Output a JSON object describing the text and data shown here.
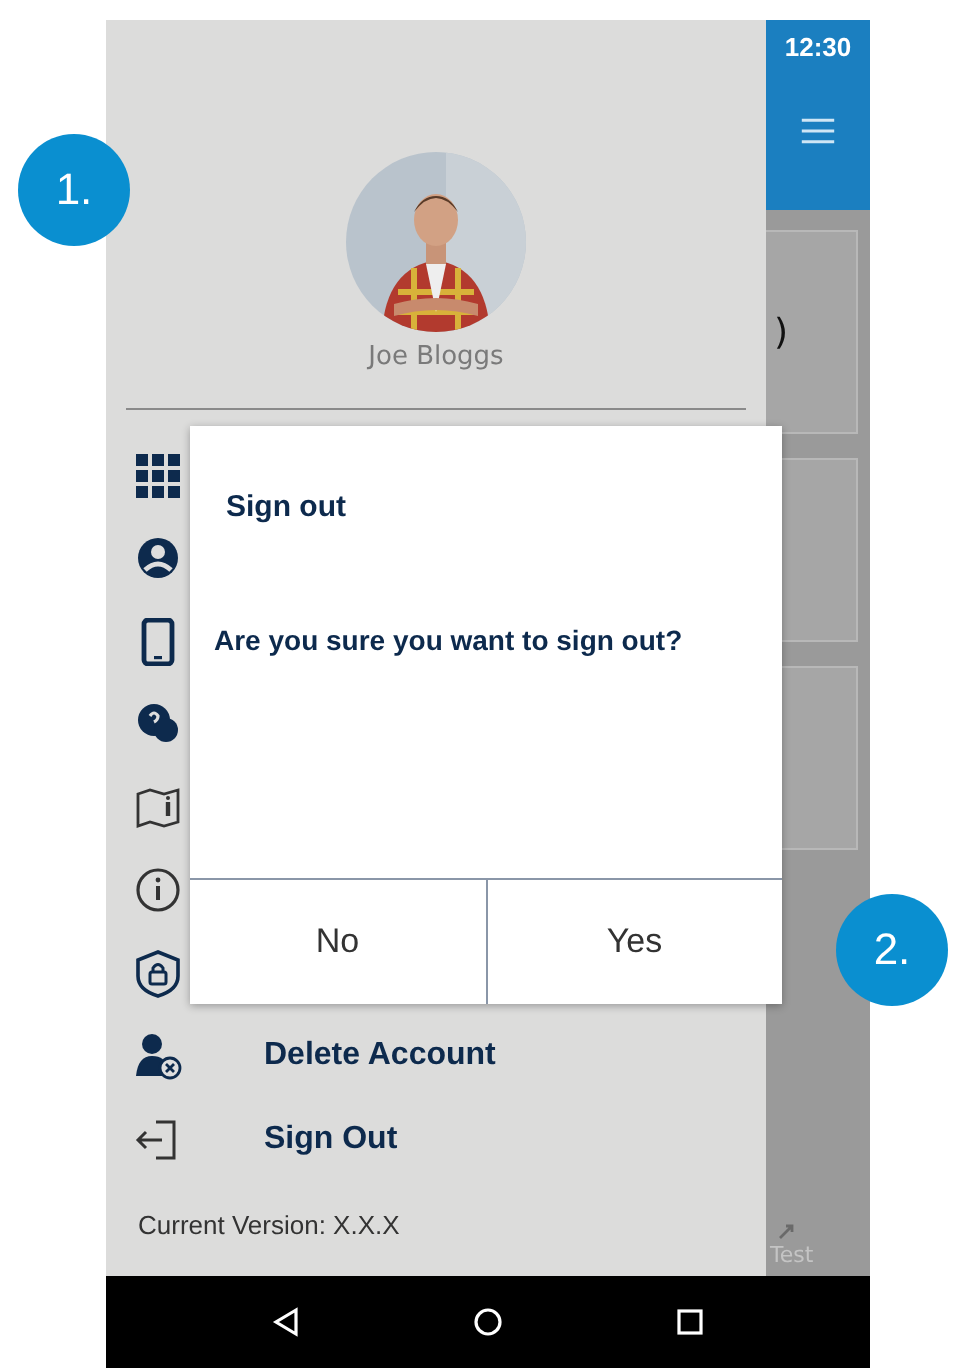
{
  "callouts": [
    {
      "label": "1."
    },
    {
      "label": "2."
    }
  ],
  "status_bar": {
    "time": "12:30"
  },
  "profile": {
    "name": "Joe Bloggs"
  },
  "menu": {
    "items": [
      {
        "label": "Delete Account"
      },
      {
        "label": "Sign Out"
      }
    ]
  },
  "version": "Current Version: X.X.X",
  "background": {
    "fragments": [
      ")",
      "Test"
    ]
  },
  "dialog": {
    "title": "Sign out",
    "message": "Are you sure you want to sign out?",
    "buttons": [
      "No",
      "Yes"
    ]
  }
}
